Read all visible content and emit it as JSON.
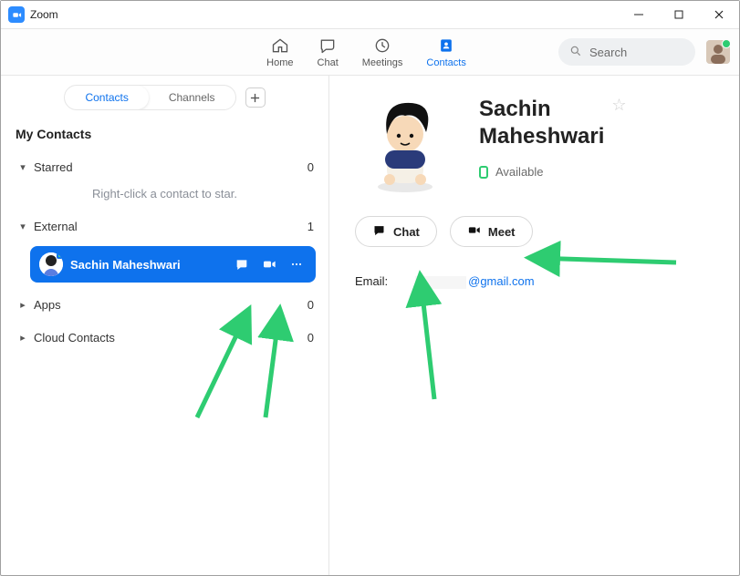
{
  "window": {
    "title": "Zoom"
  },
  "nav": {
    "home": "Home",
    "chat": "Chat",
    "meetings": "Meetings",
    "contacts": "Contacts",
    "search_placeholder": "Search"
  },
  "sidebar": {
    "tab_contacts": "Contacts",
    "tab_channels": "Channels",
    "heading": "My Contacts",
    "starred_label": "Starred",
    "starred_count": "0",
    "starred_hint": "Right-click a contact to star.",
    "external_label": "External",
    "external_count": "1",
    "contact_name": "Sachin Maheshwari",
    "apps_label": "Apps",
    "apps_count": "0",
    "cloud_label": "Cloud Contacts",
    "cloud_count": "0"
  },
  "detail": {
    "name_line1": "Sachin",
    "name_line2": "Maheshwari",
    "presence": "Available",
    "chat_btn": "Chat",
    "meet_btn": "Meet",
    "email_label": "Email:",
    "email_suffix": "@gmail.com"
  }
}
